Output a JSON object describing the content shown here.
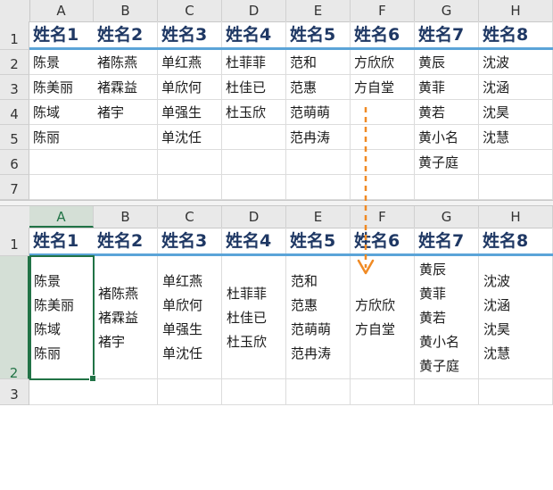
{
  "columns": [
    "A",
    "B",
    "C",
    "D",
    "E",
    "F",
    "G",
    "H"
  ],
  "sheet1_rows": [
    "1",
    "2",
    "3",
    "4",
    "5",
    "6",
    "7"
  ],
  "sheet2_rows": [
    "1",
    "2",
    "3"
  ],
  "headers": [
    "姓名1",
    "姓名2",
    "姓名3",
    "姓名4",
    "姓名5",
    "姓名6",
    "姓名7",
    "姓名8"
  ],
  "names": [
    [
      "陈景",
      "陈美丽",
      "陈域",
      "陈丽"
    ],
    [
      "褚陈燕",
      "褚霖益",
      "褚宇"
    ],
    [
      "单红燕",
      "单欣何",
      "单强生",
      "单沈任"
    ],
    [
      "杜菲菲",
      "杜佳已",
      "杜玉欣"
    ],
    [
      "范和",
      "范惠",
      "范萌萌",
      "范冉涛"
    ],
    [
      "方欣欣",
      "方自堂"
    ],
    [
      "黄辰",
      "黄菲",
      "黄若",
      "黄小名",
      "黄子庭"
    ],
    [
      "沈波",
      "沈涵",
      "沈昊",
      "沈慧"
    ]
  ],
  "colors": {
    "accent_line": "#5ba4d8",
    "arrow": "#f08a24",
    "header_text": "#1f3864",
    "selection": "#217346"
  },
  "arrow_icon": "dashed-down-arrow-icon"
}
